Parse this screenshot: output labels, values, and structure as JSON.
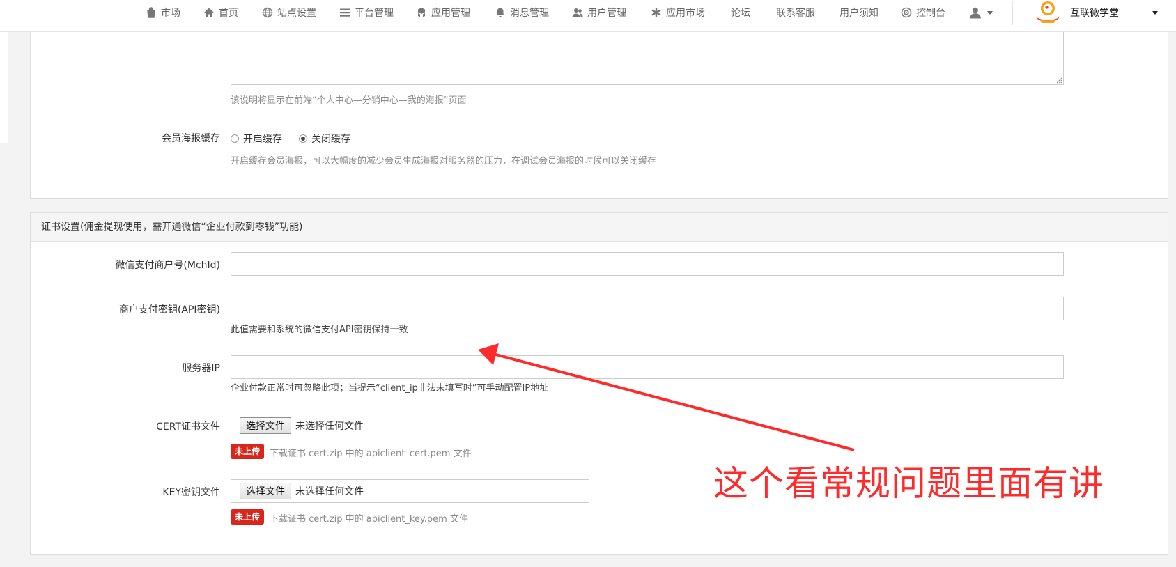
{
  "nav": {
    "items": [
      {
        "label": "市场",
        "icon": "bag-icon"
      },
      {
        "label": "首页",
        "icon": "home-icon"
      },
      {
        "label": "站点设置",
        "icon": "globe-icon"
      },
      {
        "label": "平台管理",
        "icon": "menu-icon"
      },
      {
        "label": "应用管理",
        "icon": "cubes-icon"
      },
      {
        "label": "消息管理",
        "icon": "bell-icon"
      },
      {
        "label": "用户管理",
        "icon": "users-icon"
      },
      {
        "label": "应用市场",
        "icon": "asterisk-icon"
      },
      {
        "label": "论坛",
        "icon": ""
      },
      {
        "label": "联系客服",
        "icon": ""
      },
      {
        "label": "用户须知",
        "icon": ""
      },
      {
        "label": "控制台",
        "icon": "dashboard-icon"
      }
    ],
    "user_icon": "user-icon",
    "brand_name": "互联微学堂"
  },
  "poster_panel": {
    "description_help": "该说明将显示在前端“个人中心—分销中心—我的海报”页面",
    "cache_label": "会员海报缓存",
    "cache_options": [
      {
        "label": "开启缓存",
        "checked": false
      },
      {
        "label": "关闭缓存",
        "checked": true
      }
    ],
    "cache_help": "开启缓存会员海报，可以大幅度的减少会员生成海报对服务器的压力，在调试会员海报的时候可以关闭缓存"
  },
  "cert_panel": {
    "heading": "证书设置(佣金提现使用，需开通微信“企业付款到零钱”功能)",
    "mchid_label": "微信支付商户号(MchId)",
    "mchid_value": "",
    "apikey_label": "商户支付密钥(API密钥)",
    "apikey_value": "",
    "apikey_help": "此值需要和系统的微信支付API密钥保持一致",
    "ip_label": "服务器IP",
    "ip_value": "",
    "ip_help": "企业付款正常时可忽略此项；当提示“client_ip非法未填写时”可手动配置IP地址",
    "cert_label": "CERT证书文件",
    "key_label": "KEY密钥文件",
    "file_button": "选择文件",
    "file_none": "未选择任何文件",
    "badge_text": "未上传",
    "cert_help": "下载证书 cert.zip 中的 apiclient_cert.pem 文件",
    "key_help": "下载证书 cert.zip 中的 apiclient_key.pem 文件"
  },
  "annotation": {
    "text": "这个看常规问题里面有讲",
    "color": "#ff2a2a"
  }
}
